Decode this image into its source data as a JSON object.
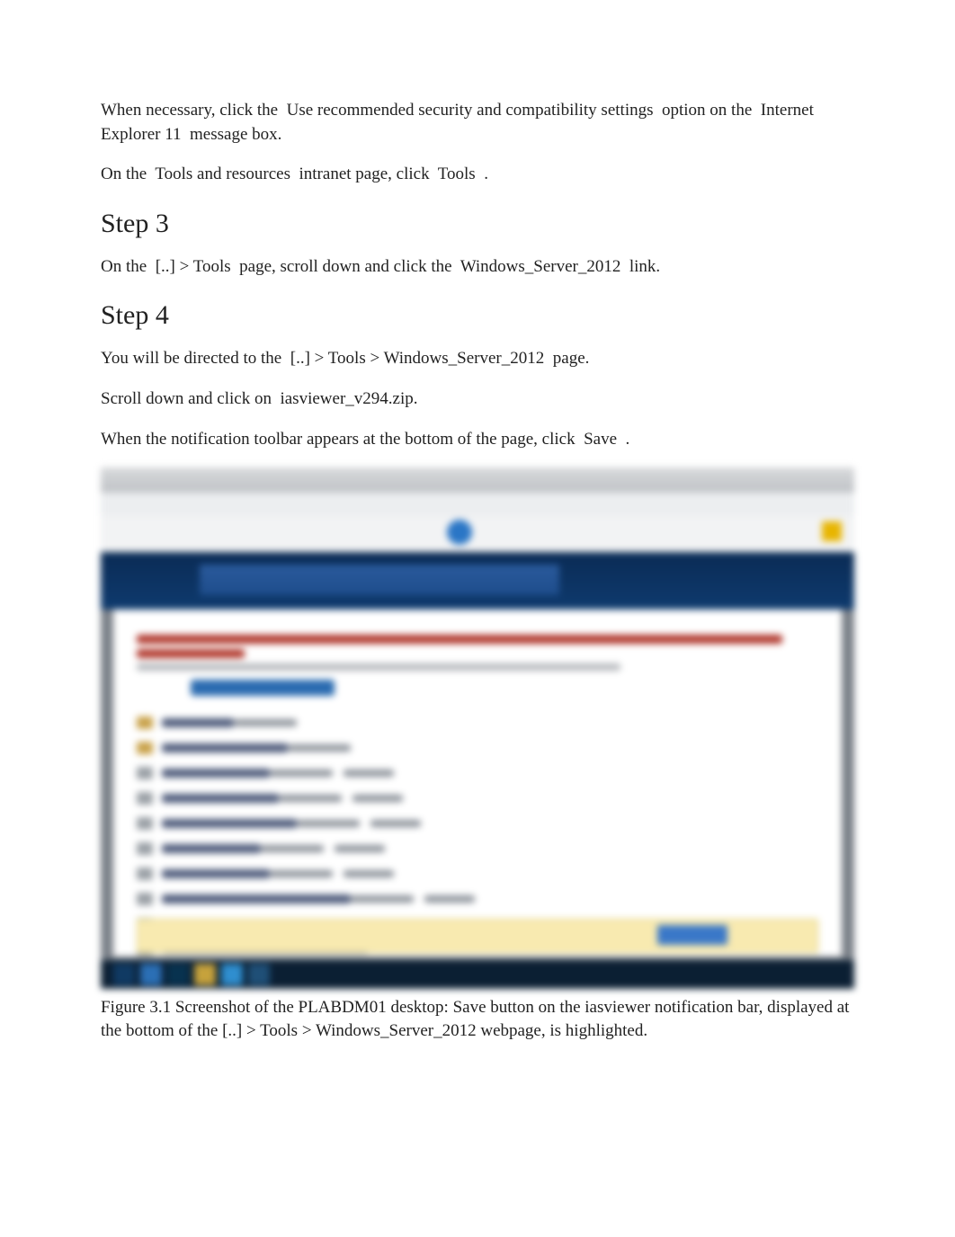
{
  "intro": {
    "p1": [
      "When necessary, click the ",
      "Use recommended security and compatibility settings",
      " option on the ",
      "Internet Explorer 11",
      " message box."
    ],
    "p2": [
      "On the ",
      "Tools and resources",
      " intranet page, click ",
      "Tools",
      " ."
    ]
  },
  "step3": {
    "heading": "Step 3",
    "p1": [
      "On the ",
      "[..] > Tools",
      " page, scroll down and click the ",
      "Windows_Server_2012",
      " link."
    ]
  },
  "step4": {
    "heading": "Step 4",
    "p1": [
      "You will be directed to the ",
      "[..] > Tools > Windows_Server_2012",
      " page."
    ],
    "p2": [
      "Scroll down and click on ",
      "iasviewer_v294.zip."
    ],
    "p3": [
      "When the notification toolbar appears at the bottom of the page, click ",
      "Save",
      " ."
    ]
  },
  "figure": {
    "caption": "Figure 3.1 Screenshot of the PLABDM01 desktop: Save button on the iasviewer notification bar, displayed at the bottom of the [..] > Tools > Windows_Server_2012 webpage, is highlighted."
  }
}
